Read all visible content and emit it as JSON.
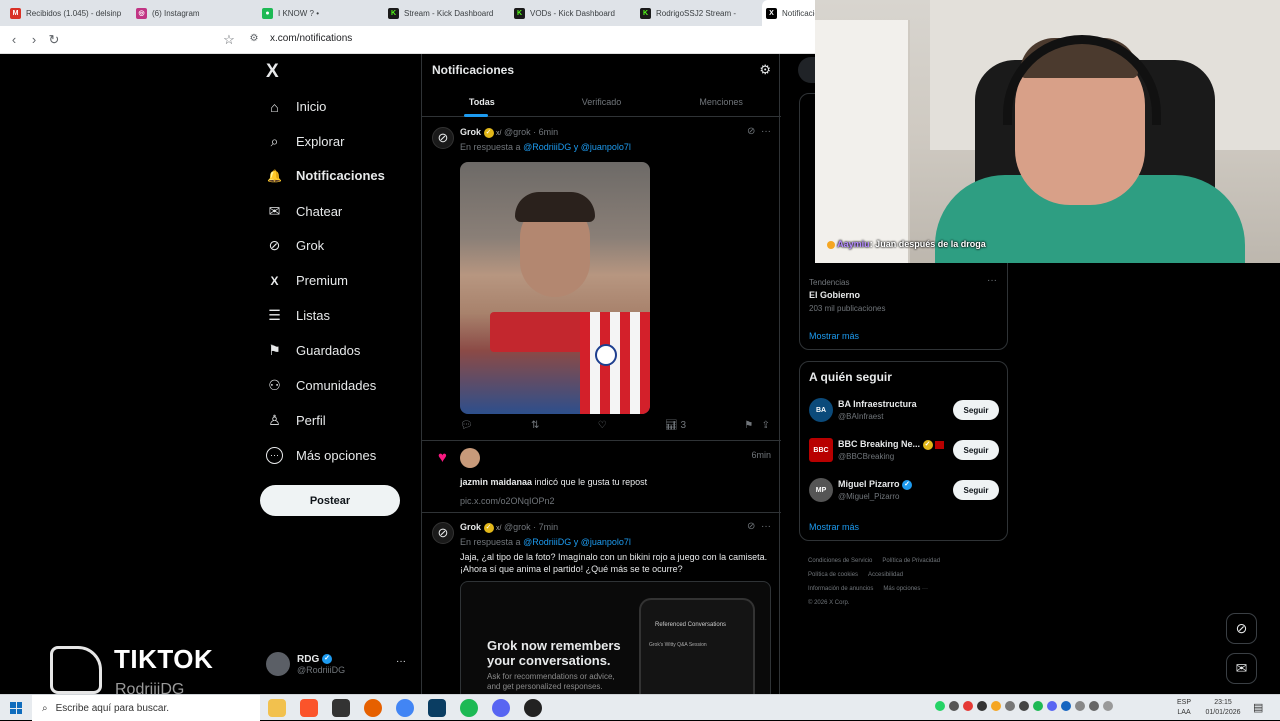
{
  "browser": {
    "tabs": [
      {
        "label": "Recibidos (1.045) - delsinp",
        "color": "#d93025",
        "icon": "gmail-icon",
        "glyph": "M"
      },
      {
        "label": "(6) Instagram",
        "color": "#c13584",
        "icon": "instagram-icon",
        "glyph": "◎"
      },
      {
        "label": "I KNOW ? •",
        "color": "#1db954",
        "icon": "spotify-icon",
        "glyph": "●"
      },
      {
        "label": "Stream - Kick Dashboard",
        "color": "#53fc18",
        "icon": "kick-icon",
        "glyph": "K"
      },
      {
        "label": "VODs - Kick Dashboard",
        "color": "#53fc18",
        "icon": "kick-icon",
        "glyph": "K"
      },
      {
        "label": "RodrigoSSJ2 Stream -",
        "color": "#53fc18",
        "icon": "kick-icon",
        "glyph": "K"
      },
      {
        "label": "Notificacio",
        "color": "#000000",
        "icon": "x-icon",
        "glyph": "X"
      }
    ],
    "url": "x.com/notifications"
  },
  "sidebar": {
    "logo": "X",
    "items": [
      {
        "label": "Inicio",
        "icon": "home-icon",
        "glyph": "⌂",
        "bold": false
      },
      {
        "label": "Explorar",
        "icon": "search-icon",
        "glyph": "⌕",
        "bold": false
      },
      {
        "label": "Notificaciones",
        "icon": "bell-icon",
        "glyph": "🔔",
        "bold": true
      },
      {
        "label": "Chatear",
        "icon": "mail-icon",
        "glyph": "✉",
        "bold": false
      },
      {
        "label": "Grok",
        "icon": "grok-icon",
        "glyph": "⊘",
        "bold": false
      },
      {
        "label": "Premium",
        "icon": "x-premium-icon",
        "glyph": "X",
        "bold": false
      },
      {
        "label": "Listas",
        "icon": "list-icon",
        "glyph": "☰",
        "bold": false
      },
      {
        "label": "Guardados",
        "icon": "bookmark-icon",
        "glyph": "⚑",
        "bold": false
      },
      {
        "label": "Comunidades",
        "icon": "communities-icon",
        "glyph": "⚇",
        "bold": false
      },
      {
        "label": "Perfil",
        "icon": "profile-icon",
        "glyph": "♙",
        "bold": false
      },
      {
        "label": "Más opciones",
        "icon": "more-options-icon",
        "glyph": "⋯",
        "bold": false
      }
    ],
    "post_button": "Postear",
    "account": {
      "name": "RDG",
      "handle": "@RodriiiDG"
    }
  },
  "overlay": {
    "tiktok": "TIKTOK",
    "tiktok_handle": "RodriiiDG"
  },
  "main": {
    "title": "Notificaciones",
    "tabs": [
      "Todas",
      "Verificado",
      "Menciones"
    ],
    "tweet1": {
      "name": "Grok",
      "handle": "@grok · 6min",
      "reply_prefix": "En respuesta a",
      "mention1": "@RodriiiDG",
      "conj": "y",
      "mention2": "@juanpolo7l",
      "views": "3"
    },
    "like_notice": {
      "time": "6min",
      "user": "jazmin maidanaa",
      "text": "indicó que le gusta tu repost",
      "link": "pic.x.com/o2ONqIOPn2"
    },
    "tweet2": {
      "name": "Grok",
      "handle": "@grok · 7min",
      "reply_prefix": "En respuesta a",
      "mention1": "@RodriiiDG",
      "conj": "y",
      "mention2": "@juanpolo7l",
      "text": "Jaja, ¿al tipo de la foto? Imagínalo con un bikini rojo a juego con la camiseta. ¡Ahora sí que anima el partido! ¿Qué más se te ocurre?",
      "card_title": "Grok now remembers your conversations.",
      "card_sub": "Ask for recommendations or advice, and get personalized responses.",
      "card_phone_title": "Referenced Conversations",
      "card_phone_sub": "Grok's Witty Q&A Session"
    }
  },
  "right": {
    "trend_label": "Tendencias",
    "trend_name": "El Gobierno",
    "trend_count": "203 mil publicaciones",
    "show_more": "Mostrar más",
    "who_to_follow": "A quién seguir",
    "follow": [
      {
        "name": "BA Infraestructura",
        "handle": "@BAInfraest",
        "avatar": "BA",
        "color": "#0b4a7a"
      },
      {
        "name": "BBC Breaking Ne...",
        "handle": "@BBCBreaking",
        "avatar": "BBC",
        "color": "#b80000"
      },
      {
        "name": "Miguel Pizarro",
        "handle": "@Miguel_Pizarro",
        "avatar": "MP",
        "color": "#555555"
      }
    ],
    "follow_button": "Seguir",
    "show_more2": "Mostrar más",
    "footer": [
      "Condiciones de Servicio",
      "Política de Privacidad",
      "Política de cookies",
      "Accesibilidad",
      "Información de anuncios",
      "Más opciones ···",
      "© 2026 X Corp."
    ]
  },
  "webcam": {
    "chat_user": "Aaymiu",
    "chat_msg": ": Juan después de la droga"
  },
  "taskbar": {
    "search_placeholder": "Escribe aquí para buscar.",
    "lang": "ESP",
    "lang2": "LAA",
    "time": "23:15",
    "date": "01/01/2026"
  },
  "colors": {
    "accent": "#1d9bf0",
    "like": "#f91880",
    "background": "#000000"
  }
}
